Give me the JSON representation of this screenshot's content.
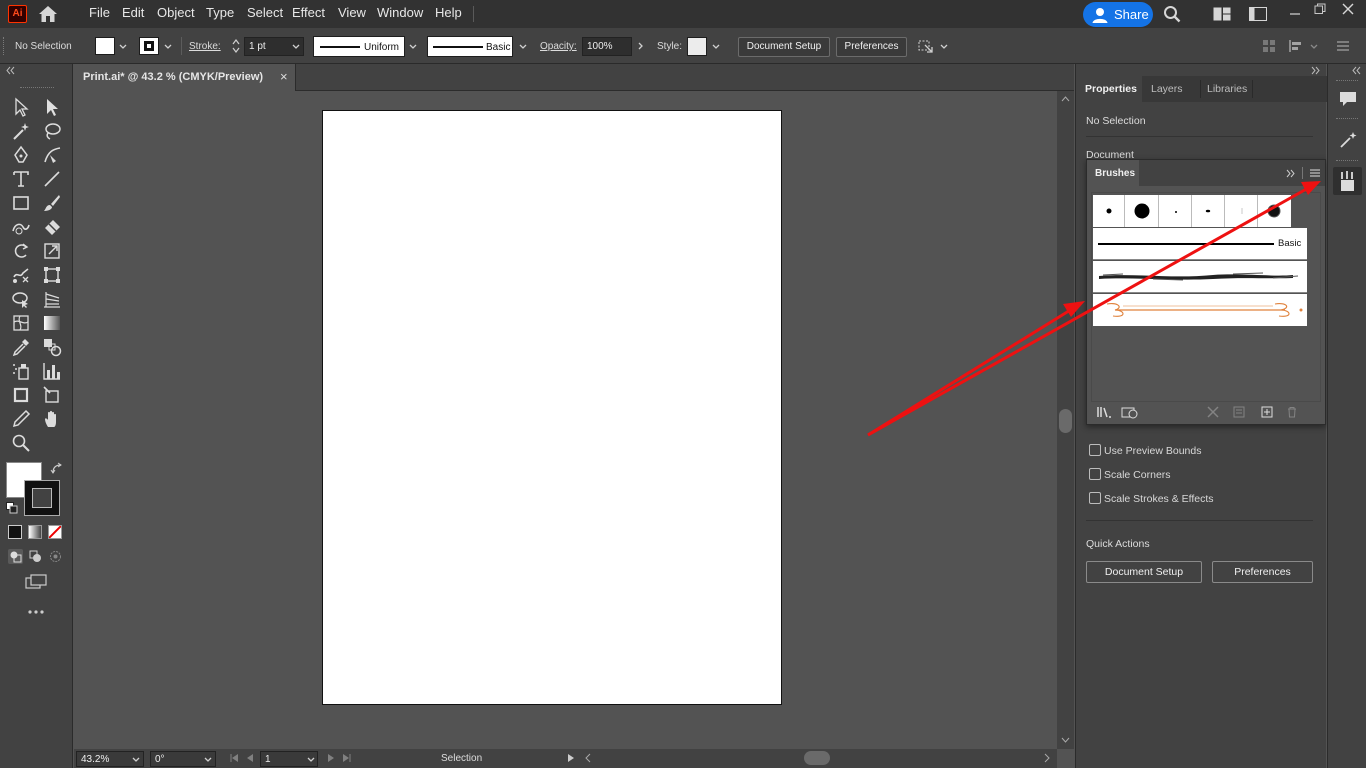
{
  "app": {
    "logo_text": "Ai",
    "logo_color": "#ff3300"
  },
  "menubar": {
    "items": [
      "File",
      "Edit",
      "Object",
      "Type",
      "Select",
      "Effect",
      "View",
      "Window",
      "Help"
    ],
    "share_label": "Share",
    "share_color": "#1473e6"
  },
  "control_bar": {
    "selection_label": "No Selection",
    "stroke_label": "Stroke:",
    "stroke_weight": "1 pt",
    "variable_width_profile": "Uniform",
    "brush_definition": "Basic",
    "opacity_label": "Opacity:",
    "opacity_value": "100%",
    "style_label": "Style:",
    "document_setup_label": "Document Setup",
    "preferences_label": "Preferences"
  },
  "document_tab": {
    "title": "Print.ai* @ 43.2 % (CMYK/Preview)",
    "close_glyph": "×"
  },
  "statusbar": {
    "zoom": "43.2%",
    "rotation": "0°",
    "artboard_number": "1",
    "tool_name": "Selection"
  },
  "properties_panel": {
    "tabs": [
      "Properties",
      "Layers",
      "Libraries"
    ],
    "selection_text": "No Selection",
    "section_document": "Document",
    "checkboxes": [
      "Use Preview Bounds",
      "Scale Corners",
      "Scale Strokes & Effects"
    ],
    "quick_actions_title": "Quick Actions",
    "document_setup_label": "Document Setup",
    "preferences_label": "Preferences"
  },
  "brushes_panel": {
    "title": "Brushes",
    "brush_rows": [
      "Basic"
    ]
  },
  "annotation": {
    "arrow_color": "#ee1111"
  }
}
